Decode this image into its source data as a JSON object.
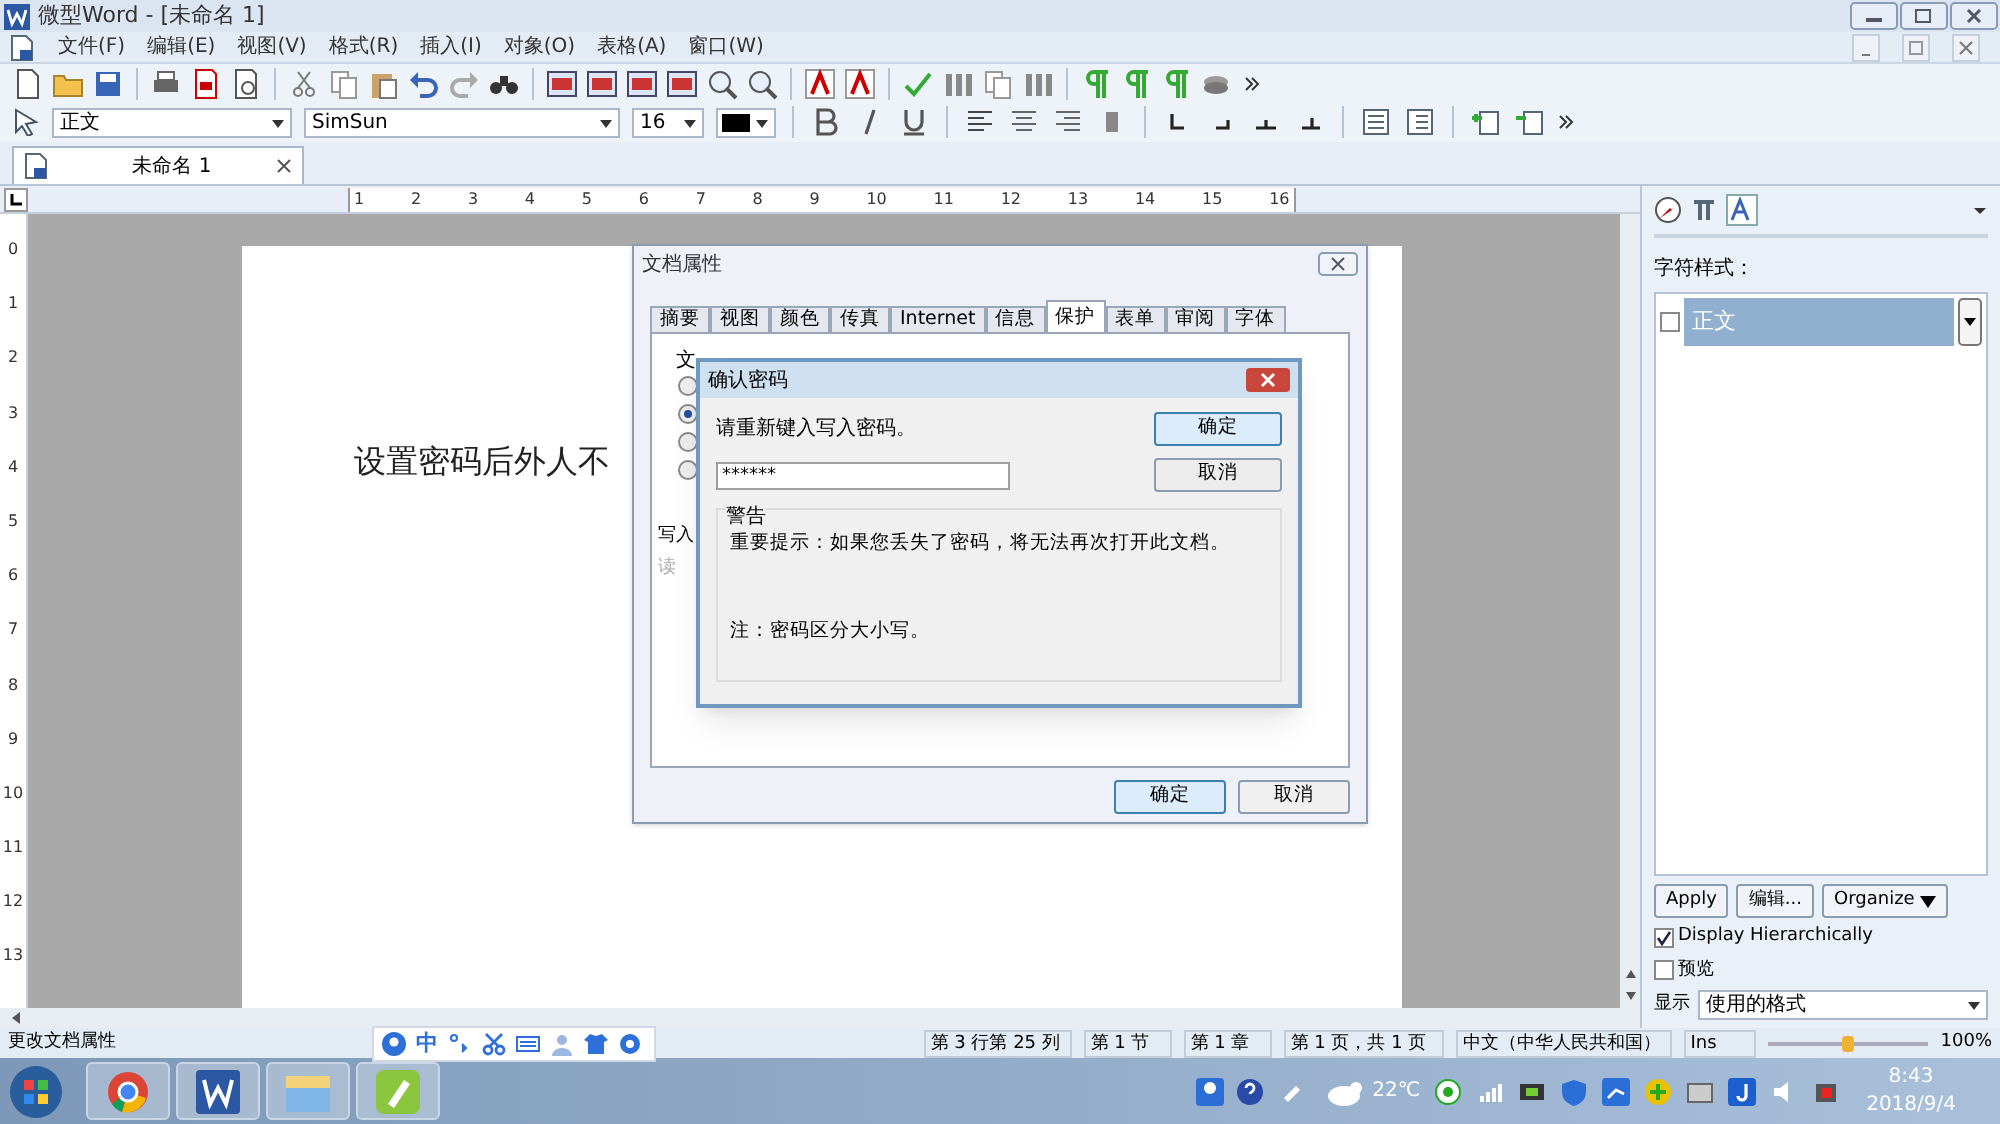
{
  "window": {
    "title": "微型Word - [未命名 1]"
  },
  "menu": [
    "文件(F)",
    "编辑(E)",
    "视图(V)",
    "格式(R)",
    "插入(I)",
    "对象(O)",
    "表格(A)",
    "窗口(W)"
  ],
  "format_bar": {
    "style": "正文",
    "font": "SimSun",
    "size": "16"
  },
  "doc_tabs": [
    {
      "label": "未命名 1",
      "selected": true
    }
  ],
  "ruler": {
    "h": [
      "1",
      "2",
      "3",
      "4",
      "5",
      "6",
      "7",
      "8",
      "9",
      "10",
      "11",
      "12",
      "13",
      "14",
      "15",
      "16"
    ],
    "v": [
      "0",
      "1",
      "2",
      "3",
      "4",
      "5",
      "6",
      "7",
      "8",
      "9",
      "10",
      "11",
      "12",
      "13"
    ]
  },
  "document": {
    "text": "设置密码后外人不"
  },
  "properties_dialog": {
    "title": "文档属性",
    "tabs": [
      {
        "label": "摘要",
        "selected": false
      },
      {
        "label": "视图",
        "selected": false
      },
      {
        "label": "颜色",
        "selected": false
      },
      {
        "label": "传真",
        "selected": false
      },
      {
        "label": "Internet",
        "selected": false
      },
      {
        "label": "信息",
        "selected": false
      },
      {
        "label": "保护",
        "selected": true
      },
      {
        "label": "表单",
        "selected": false
      },
      {
        "label": "审阅",
        "selected": false
      },
      {
        "label": "字体",
        "selected": false
      }
    ],
    "group_label": "文",
    "radios": [
      {
        "selected": false
      },
      {
        "selected": true
      },
      {
        "selected": false
      },
      {
        "selected": false
      }
    ],
    "write_label": "写入",
    "read_label": "读",
    "buttons": [
      "确定",
      "取消"
    ]
  },
  "confirm_dialog": {
    "title": "确认密码",
    "prompt": "请重新键入写入密码。",
    "value": "******",
    "buttons": [
      "确定",
      "取消"
    ],
    "warning_title": "警告",
    "warning": "重要提示：如果您丢失了密码，将无法再次打开此文档。",
    "note": "注：密码区分大小写。"
  },
  "side_panel": {
    "heading": "字符样式：",
    "styles": [
      {
        "label": "正文",
        "checked": false,
        "selected": true
      }
    ],
    "buttons": [
      "Apply",
      "编辑...",
      "Organize"
    ],
    "checkboxes": [
      {
        "label": "Display Hierarchically",
        "checked": true
      },
      {
        "label": "预览",
        "checked": false
      }
    ],
    "show_label": "显示",
    "show_value": "使用的格式"
  },
  "status_bar": {
    "message": "更改文档属性",
    "fields": [
      "第 3 行第 25 列",
      "第 1 节",
      "第 1 章",
      "第 1 页，共 1 页",
      "中文（中华人民共和国）",
      "Ins"
    ],
    "zoom": {
      "level": 0.5
    },
    "zoom_text": "100%"
  },
  "ime_bar": {
    "label": "中"
  },
  "taskbar": {
    "weather": "22℃",
    "time": "8:43",
    "date": "2018/9/4"
  }
}
